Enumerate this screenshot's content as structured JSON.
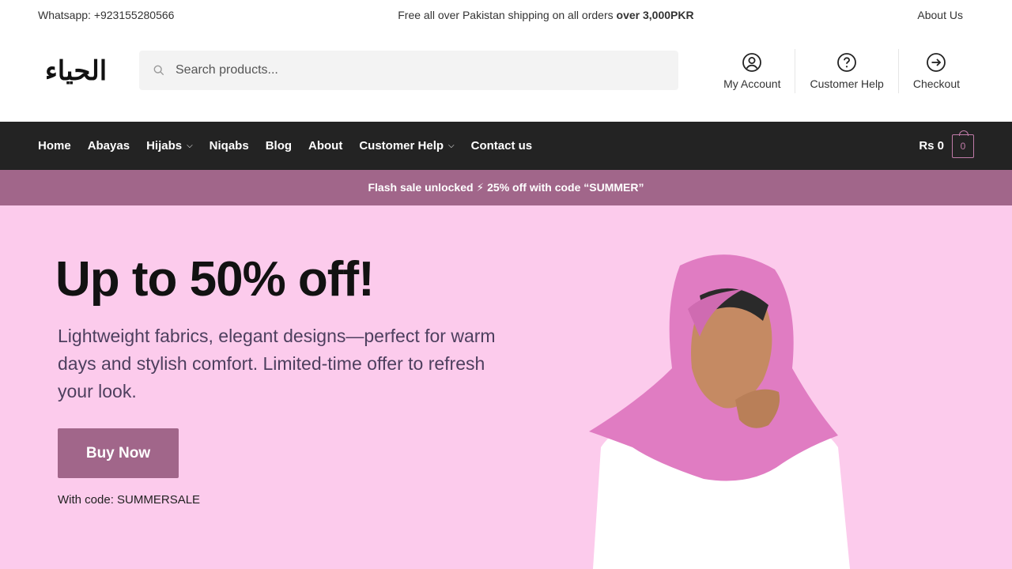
{
  "topbar": {
    "whatsapp": "Whatsapp: +923155280566",
    "promo_prefix": "Free all over Pakistan shipping on all orders ",
    "promo_bold": "over 3,000PKR",
    "about": "About Us"
  },
  "header": {
    "logo": "الحياء",
    "search_placeholder": "Search products...",
    "links": [
      "My Account",
      "Customer Help",
      "Checkout"
    ]
  },
  "nav": {
    "items": [
      "Home",
      "Abayas",
      "Hijabs",
      "Niqabs",
      "Blog",
      "About",
      "Customer Help",
      "Contact us"
    ],
    "cart_total": "Rs 0",
    "cart_count": "0"
  },
  "flash": "Flash sale unlocked ⚡ 25% off with code “SUMMER”",
  "hero": {
    "title": "Up to 50% off!",
    "description": "Lightweight fabrics, elegant designs—perfect for warm days and stylish comfort. Limited-time offer to refresh your look.",
    "button": "Buy Now",
    "code": "With code: SUMMERSALE"
  },
  "colors": {
    "accent": "#a1668a",
    "hero_bg": "#fccbec",
    "nav_bg": "#232323"
  }
}
